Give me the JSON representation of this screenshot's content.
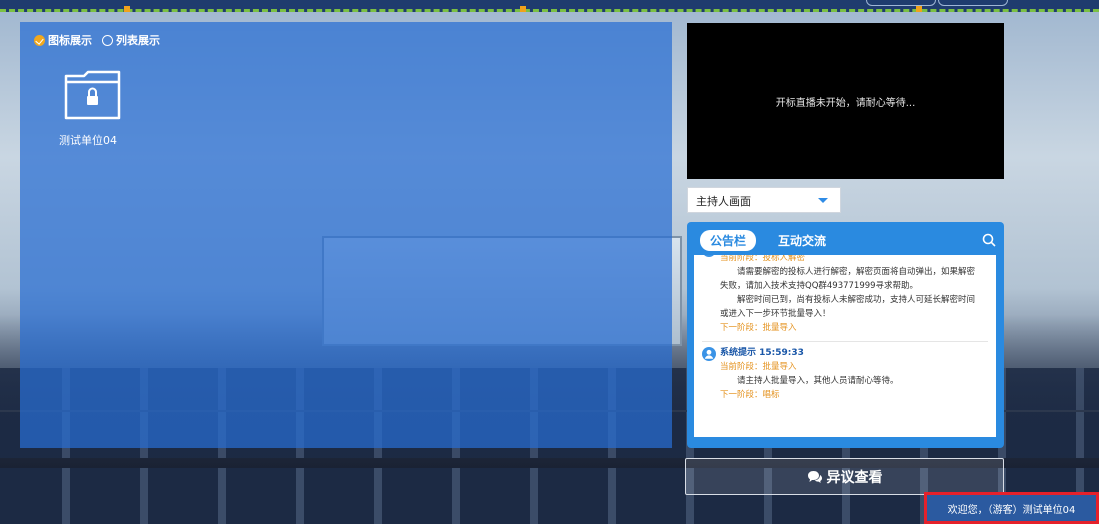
{
  "view_toggle": {
    "icon_view": "图标展示",
    "list_view": "列表展示",
    "selected": "icon_view"
  },
  "units": [
    {
      "name": "测试单位04",
      "icon": "lock-icon"
    }
  ],
  "live": {
    "status_text": "开标直播未开始，请耐心等待...",
    "camera_select": "主持人画面"
  },
  "bulletin": {
    "tabs": [
      "公告栏",
      "互动交流"
    ],
    "active_tab": 0,
    "messages": [
      {
        "stage": "当前阶段：投标人解密",
        "line1": "请需要解密的投标人进行解密，解密页面将自动弹出，如果解密",
        "line2": "失败，请加入技术支持QQ群493771999寻求帮助。",
        "line3": "解密时间已到，尚有投标人未解密成功，支持人可延长解密时间",
        "line4": "或进入下一步环节批量导入！",
        "next": "下一阶段：批量导入"
      },
      {
        "sender": "系统提示 15:59:33",
        "stage": "当前阶段：批量导入",
        "line1": "请主持人批量导入，其他人员请耐心等待。",
        "next": "下一阶段：唱标"
      }
    ]
  },
  "objection_button": "异议查看",
  "welcome": "欢迎您，（游客）测试单位04",
  "colors": {
    "panel": "#286ED2",
    "accent": "#2A8AE0",
    "stage": "#E4921E",
    "checked": "#F2A81D",
    "highlight_border": "#E5212B"
  }
}
